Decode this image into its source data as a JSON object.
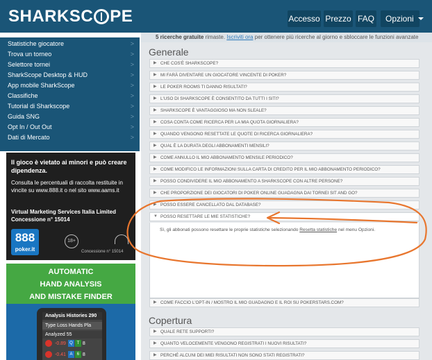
{
  "header": {
    "logo_left": "SHARKSC",
    "logo_right": "PE",
    "nav": [
      {
        "label": "Accesso"
      },
      {
        "label": "Prezzo"
      },
      {
        "label": "FAQ"
      },
      {
        "label": "Opzioni"
      }
    ]
  },
  "sidebar": {
    "items": [
      {
        "label": "Statistiche giocatore"
      },
      {
        "label": "Trova un torneo"
      },
      {
        "label": "Selettore tornei"
      },
      {
        "label": "SharkScope Desktop & HUD"
      },
      {
        "label": "App mobile SharkScope"
      },
      {
        "label": "Classifiche"
      },
      {
        "label": "Tutorial di Sharkscope"
      },
      {
        "label": "Guida SNG"
      },
      {
        "label": "Opt In / Out Out"
      },
      {
        "label": "Dati di Mercato"
      }
    ],
    "ad1": {
      "line1": "Il gioco è vietato ai minori e può creare dipendenza.",
      "line2": "Consulta le percentuali di raccolta restituite in vincite su www.888.it o nel sito www.aams.it",
      "line3": "Virtual Marketing Services Italia Limited Concessione n° 15014",
      "logo": "888",
      "logo_small": "poker.it",
      "age": "18+",
      "concessione": "Concessione n° 15014"
    },
    "ad2": {
      "line1": "AUTOMATIC",
      "line2": "HAND ANALYSIS",
      "line3": "AND MISTAKE FINDER",
      "screen": {
        "row1": "Analysis   Histories 290",
        "row2": "Type  Loss  Hands  Pla",
        "row3": "Analyzed  55",
        "row4_value": "-0.89",
        "row4_cards": [
          "Q",
          "T"
        ],
        "row4_tail": "8",
        "row5_value": "-0.41",
        "row5_cards": [
          "A",
          "6"
        ],
        "row5_tail": "8"
      }
    }
  },
  "banner": {
    "strong": "5 ricerche gratuite",
    "text1": " rimaste. ",
    "link": "Iscriviti ora",
    "text2": " per ottenere più ricerche al giorno e sbloccare le funzioni avanzate"
  },
  "content": {
    "section1_title": "Generale",
    "faqs_general": [
      "CHE COS'È SHARKSCOPE?",
      "MI FARÀ DIVENTARE UN GIOCATORE VINCENTE DI POKER?",
      "LE POKER ROOMS TI DANNO RISULTATI?",
      "L'USO DI SHARKSCOPE È CONSENTITO DA TUTTI I SITI?",
      "SHARKSCOPE È VANTAGGIOSO MA NON SLEALE?",
      "COSA CONTA COME RICERCA PER LA MIA QUOTA GIORNALIERA?",
      "QUANDO VENGONO RESETTATE LE QUOTE DI RICERCA GIORNALIERA?",
      "QUAL È LA DURATA DEGLI ABBONAMENTI MENSILI?",
      "COME ANNULLO IL MIO ABBONAMENTO MENSILE PERIODICO?",
      "COME MODIFICO LE INFORMAZIONI SULLA CARTA DI CREDITO PER IL MIO ABBONAMENTO PERIODICO?",
      "POSSO CONDIVIDERE IL MIO ABBONAMENTO A SHARKSCOPE CON ALTRE PERSONE?",
      "CHE PROPORZIONE DEI GIOCATORI DI POKER ONLINE GUADAGNA DAI TORNEI SIT AND GO?",
      "POSSO ESSERE CANCELLATO DAL DATABASE?"
    ],
    "faq_open": "POSSO RESETTARE LE MIE STATISTICHE?",
    "answer_before": "Sì, gli abbonati possono resettare le proprie statistiche selezionando ",
    "answer_link": "Resetta statistiche",
    "answer_after": " nel menu Opzioni.",
    "faq_after_open": "COME FACCIO L'OPT-IN / MOSTRO IL MIO GUADAGNO E IL ROI SU POKERSTARS.COM?",
    "section2_title": "Copertura",
    "faqs_coverage": [
      "QUALE RETE SUPPORTI?",
      "QUANTO VELOCEMENTE VENGONO REGISTRATI I NUOVI RISULTATI?",
      "PERCHÉ ALCUNI DEI MIEI RISULTATI NON SONO STATI REGISTRATI?"
    ]
  },
  "colors": {
    "header": "#1a5577",
    "content_bg": "#e4e7ea",
    "annotation": "#e8762e"
  }
}
